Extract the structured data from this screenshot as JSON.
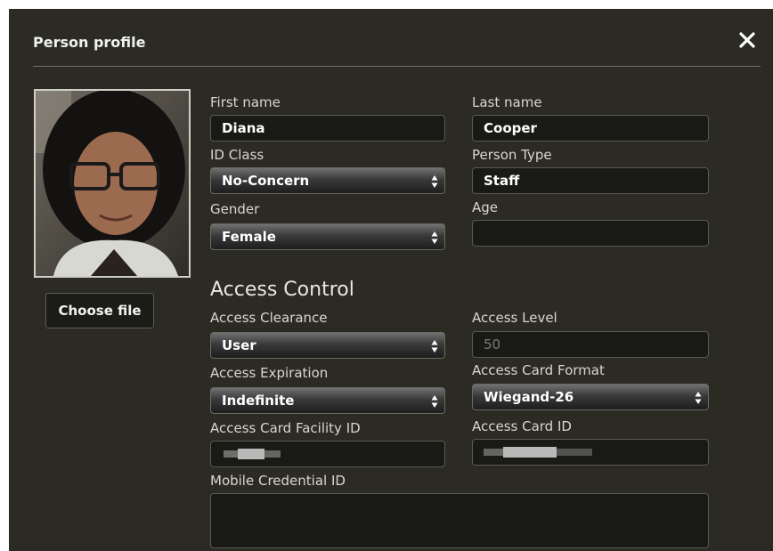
{
  "dialog": {
    "title": "Person profile",
    "close_icon": "close-icon"
  },
  "photo": {
    "icon": "person-photo"
  },
  "choose_file_label": "Choose file",
  "fields": {
    "first_name": {
      "label": "First name",
      "value": "Diana"
    },
    "last_name": {
      "label": "Last name",
      "value": "Cooper"
    },
    "id_class": {
      "label": "ID Class",
      "value": "No-Concern"
    },
    "person_type": {
      "label": "Person Type",
      "value": "Staff"
    },
    "gender": {
      "label": "Gender",
      "value": "Female"
    },
    "age": {
      "label": "Age",
      "value": ""
    }
  },
  "access_control": {
    "heading": "Access Control",
    "access_clearance": {
      "label": "Access Clearance",
      "value": "User"
    },
    "access_level": {
      "label": "Access Level",
      "value": "50"
    },
    "access_expiration": {
      "label": "Access Expiration",
      "value": "Indefinite"
    },
    "access_card_format": {
      "label": "Access Card Format",
      "value": "Wiegand-26"
    },
    "access_card_facility_id": {
      "label": "Access Card Facility ID"
    },
    "access_card_id": {
      "label": "Access Card ID"
    },
    "mobile_credential_id": {
      "label": "Mobile Credential ID",
      "value": ""
    }
  },
  "colors": {
    "dialog_bg": "#2b2b24",
    "field_bg": "#191915",
    "text": "#ffffff"
  }
}
